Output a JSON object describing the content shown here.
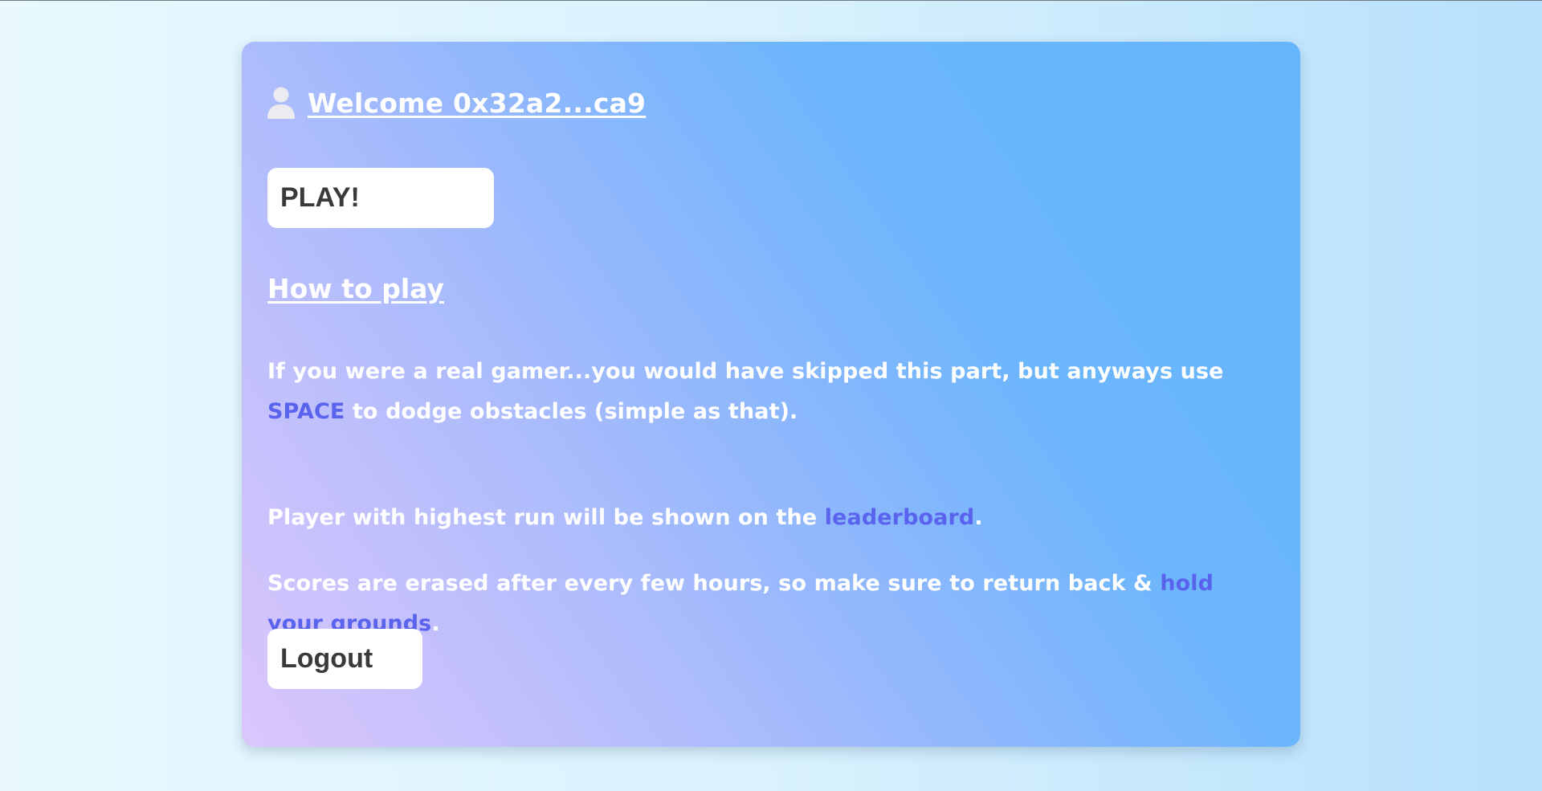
{
  "welcome": {
    "text": "Welcome 0x32a2...ca9",
    "icon": "user-icon"
  },
  "buttons": {
    "play_label": "PLAY!",
    "logout_label": "Logout"
  },
  "how_to_play": {
    "title": "How to play",
    "paragraph1": {
      "before": "If you were a real gamer...you would have skipped this part, but anyways use ",
      "key": "SPACE",
      "after": " to dodge obstacles (simple as that)."
    },
    "paragraph2": {
      "before": "Player with highest run will be shown on the ",
      "link": "leaderboard",
      "after": "."
    },
    "paragraph3": {
      "before": "Scores are erased after every few hours, so make sure to return back & ",
      "accent": "hold your grounds",
      "after": "."
    }
  },
  "colors": {
    "accent": "#5a63ee",
    "text": "#ffffff",
    "button_text": "#3a3a3a",
    "card_gradient_start": "#dcc6fc",
    "card_gradient_end": "#66b5fb"
  }
}
